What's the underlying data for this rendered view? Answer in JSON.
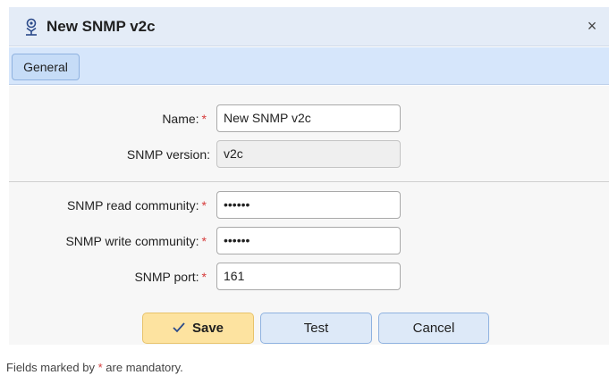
{
  "dialog": {
    "title": "New SNMP v2c",
    "close_label": "×"
  },
  "tabs": [
    {
      "label": "General",
      "active": true
    }
  ],
  "form": {
    "required_marker": "*",
    "fields": {
      "name": {
        "label": "Name:",
        "value": "New SNMP v2c",
        "required": true
      },
      "snmp_version": {
        "label": "SNMP version:",
        "value": "v2c",
        "required": false
      },
      "read_community": {
        "label": "SNMP read community:",
        "value": "••••••",
        "required": true
      },
      "write_community": {
        "label": "SNMP write community:",
        "value": "••••••",
        "required": true
      },
      "snmp_port": {
        "label": "SNMP port:",
        "value": "161",
        "required": true
      }
    }
  },
  "buttons": {
    "save": "Save",
    "test": "Test",
    "cancel": "Cancel"
  },
  "footer": {
    "before": "Fields marked by",
    "after": "are mandatory."
  },
  "colors": {
    "accent": "#d6e6fb",
    "save_bg": "#fde3a0",
    "required": "#d63b3b"
  },
  "icons": {
    "title": "snmp-device-icon",
    "save": "checkmark-icon",
    "close": "close-icon"
  }
}
